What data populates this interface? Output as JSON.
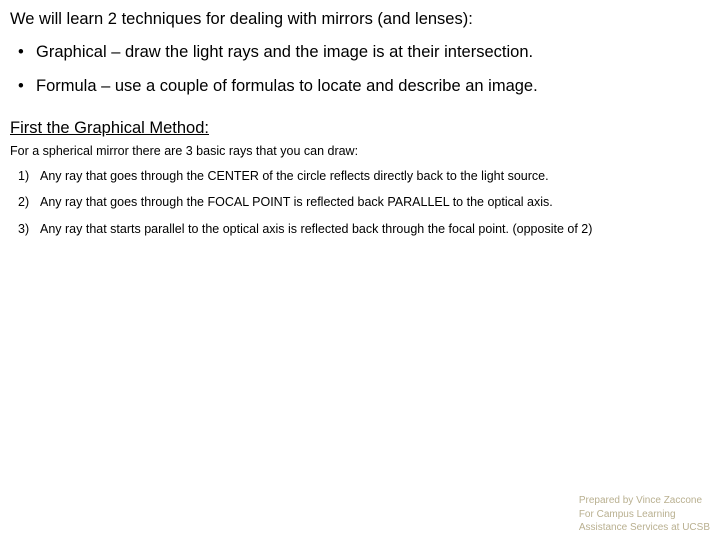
{
  "intro": "We will learn 2 techniques for dealing with mirrors (and lenses):",
  "techniques": [
    "Graphical – draw the light rays and the image is at their intersection.",
    "Formula – use a couple of formulas to locate and describe an image."
  ],
  "subhead": "First the Graphical Method:",
  "sphere_intro": "For a spherical mirror there are 3 basic rays that you can draw:",
  "rays": [
    "Any ray that goes through the CENTER of the circle reflects directly back to the light source.",
    "Any ray that goes through the FOCAL POINT is reflected back PARALLEL to the optical axis.",
    "Any ray that starts parallel to the optical axis is reflected back through the focal point. (opposite of 2)"
  ],
  "footer": {
    "line1": "Prepared by Vince Zaccone",
    "line2a": "For Campus Learning",
    "line2b": "Assistance Services at UCSB"
  }
}
